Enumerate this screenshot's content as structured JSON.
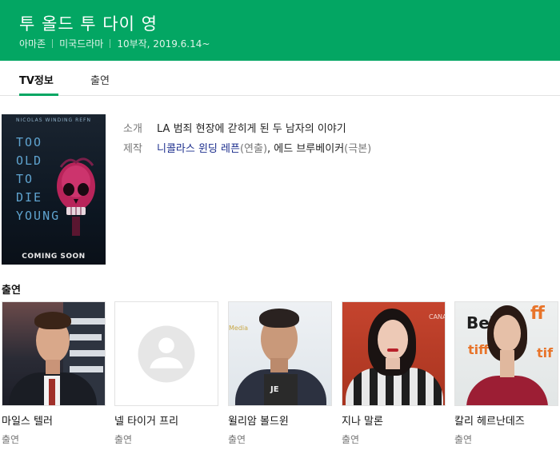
{
  "header": {
    "title": "투 올드 투 다이 영",
    "meta": [
      "아마존",
      "미국드라마",
      "10부작, 2019.6.14~"
    ]
  },
  "tabs": [
    {
      "label": "TV정보",
      "active": true
    },
    {
      "label": "출연",
      "active": false
    }
  ],
  "poster": {
    "director_text": "NICOLAS WINDING REFN",
    "title_lines": [
      "TOO",
      "OLD",
      "TO",
      "DIE",
      "YOUNG"
    ],
    "coming_text": "COMING SOON"
  },
  "info": {
    "intro_label": "소개",
    "intro_text": "LA 범죄 현장에 갇히게 된 두 남자의 이야기",
    "credit_label": "제작",
    "director_name": "니콜라스 윈딩 레픈",
    "director_role": "(연출)",
    "separator": ", ",
    "writer_name": "에드 브루베이커",
    "writer_role": "(극본)"
  },
  "cast_heading": "출연",
  "cast": [
    {
      "name": "마일스 텔러",
      "role": "출연"
    },
    {
      "name": "넬 타이거 프리",
      "role": "출연"
    },
    {
      "name": "윌리암 볼드윈",
      "role": "출연"
    },
    {
      "name": "지나 말론",
      "role": "출연"
    },
    {
      "name": "칼리 헤르난데즈",
      "role": "출연"
    }
  ],
  "colors": {
    "brand_green": "#03a663",
    "link_blue": "#1a2c8c"
  }
}
